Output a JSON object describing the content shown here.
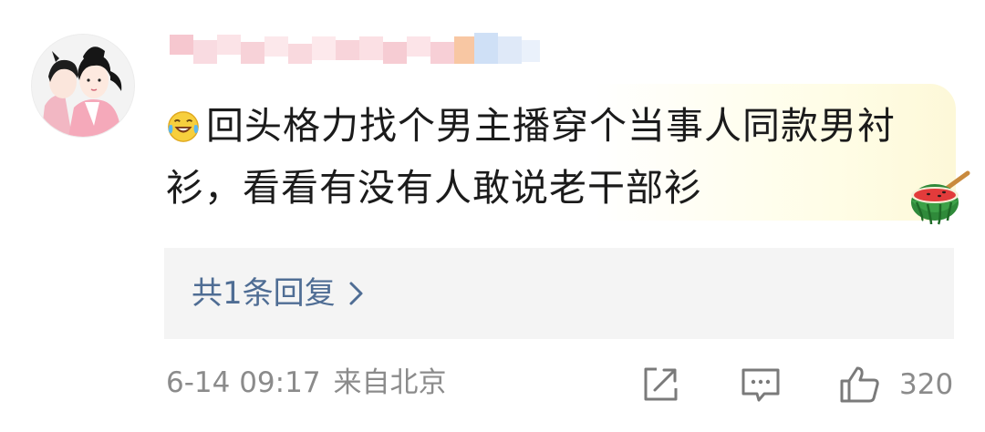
{
  "comment": {
    "author_name": "",
    "text_line1": "回头格力找个男主播穿个当事人同款男衬",
    "text_line2": "衫，看看有没有人敢说老干部衫",
    "emoji_icon": "laugh-cry-icon",
    "decoration_icon": "watermelon-icon"
  },
  "replies": {
    "label": "共1条回复"
  },
  "meta": {
    "date_time": "6-14 09:17",
    "location": "来自北京"
  },
  "actions": {
    "share_icon": "share-icon",
    "reply_icon": "comment-icon",
    "like_icon": "thumbs-up-icon",
    "like_count": "320"
  },
  "colors": {
    "link": "#4f6d94",
    "meta": "#8b8b8b",
    "reply_bg": "#f4f4f4"
  }
}
